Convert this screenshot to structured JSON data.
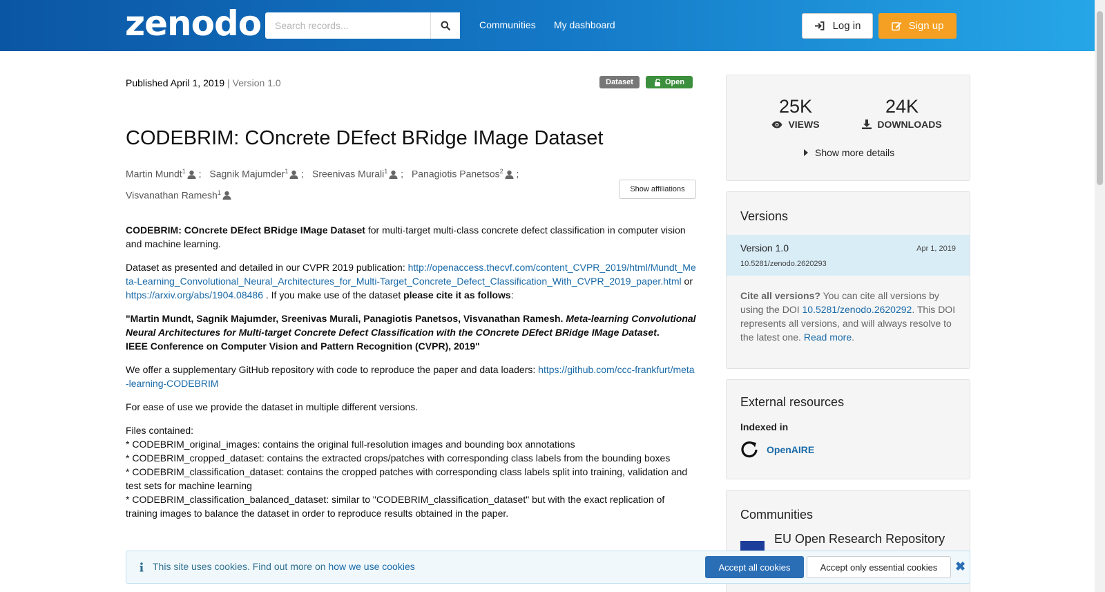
{
  "header": {
    "logo": "zenodo",
    "search_placeholder": "Search records...",
    "nav": [
      "Communities",
      "My dashboard"
    ],
    "login": "Log in",
    "signup": "Sign up"
  },
  "record": {
    "published": "Published April 1, 2019",
    "version": "| Version 1.0",
    "badge_type": "Dataset",
    "badge_access": "Open",
    "title": "CODEBRIM: COncrete DEfect BRidge IMage Dataset",
    "authors": [
      {
        "name": "Martin Mundt",
        "aff": "1"
      },
      {
        "name": "Sagnik Majumder",
        "aff": "1"
      },
      {
        "name": "Sreenivas Murali",
        "aff": "1"
      },
      {
        "name": "Panagiotis Panetsos",
        "aff": "2"
      },
      {
        "name": "Visvanathan Ramesh",
        "aff": "1"
      }
    ],
    "show_affiliations": "Show affiliations"
  },
  "description": {
    "p1_bold": "CODEBRIM: COncrete DEfect BRidge IMage Dataset",
    "p1_rest": " for multi-target multi-class concrete defect classification in computer vision and machine learning.",
    "p2_a": "Dataset as presented and detailed in our CVPR 2019 publication: ",
    "p2_link1": "http://openaccess.thecvf.com/content_CVPR_2019/html/Mundt_Meta-Learning_Convolutional_Neural_Architectures_for_Multi-Target_Concrete_Defect_Classification_With_CVPR_2019_paper.html",
    "p2_or": " or ",
    "p2_link2": "https://arxiv.org/abs/1904.08486",
    "p2_b": " . If you make use of the dataset ",
    "p2_bold": "please cite it as follows",
    "p2_c": ":",
    "cite_authors": "\"Martin Mundt, Sagnik Majumder, Sreenivas Murali, Panagiotis Panetsos, Visvanathan Ramesh. ",
    "cite_title": "Meta-learning Convolutional Neural Architectures for Multi-target Concrete Defect Classification with the COncrete DEfect BRidge IMage Dataset",
    "cite_dot": ".",
    "cite_venue": "IEEE Conference on Computer Vision and Pattern Recognition (CVPR), 2019\"",
    "p4_a": "We offer a supplementary GitHub repository with code to reproduce the paper and data loaders: ",
    "p4_link": "https://github.com/ccc-frankfurt/meta-learning-CODEBRIM",
    "p5": "For ease of use we provide the dataset in multiple different versions.",
    "files_heading": "Files contained:",
    "files": [
      "* CODEBRIM_original_images: contains the original full-resolution images and bounding box annotations",
      "* CODEBRIM_cropped_dataset: contains the extracted crops/patches with corresponding class labels from the bounding boxes",
      "* CODEBRIM_classification_dataset: contains the cropped patches with corresponding class labels split into training, validation and test sets for machine learning",
      "* CODEBRIM_classification_balanced_dataset: similar to \"CODEBRIM_classification_dataset\" but with the exact replication of training images to balance the dataset in order to reproduce results obtained in the paper."
    ]
  },
  "sidebar": {
    "views": "25K",
    "views_label": "VIEWS",
    "downloads": "24K",
    "downloads_label": "DOWNLOADS",
    "more_details": "Show more details",
    "versions_title": "Versions",
    "version_name": "Version 1.0",
    "version_date": "Apr 1, 2019",
    "version_doi": "10.5281/zenodo.2620293",
    "cite_bold": "Cite all versions?",
    "cite_a": " You can cite all versions by using the DOI ",
    "cite_doi": "10.5281/zenodo.2620292",
    "cite_b": ". This DOI represents all versions, and will always resolve to the latest one. ",
    "cite_more": "Read more",
    "cite_end": ".",
    "external_title": "External resources",
    "indexed_in": "Indexed in",
    "openaire": "OpenAIRE",
    "communities_title": "Communities",
    "community_name": "EU Open Research Repository"
  },
  "cookie": {
    "text": "This site uses cookies. Find out more on ",
    "link": "how we use cookies",
    "accept_all": "Accept all cookies",
    "accept_essential": "Accept only essential cookies"
  },
  "colors": {
    "header_start": "#0b56a4",
    "header_end": "#26a7e8",
    "signup": "#f5a022",
    "open_badge": "#3c8f3c",
    "link": "#1a6aa8"
  }
}
